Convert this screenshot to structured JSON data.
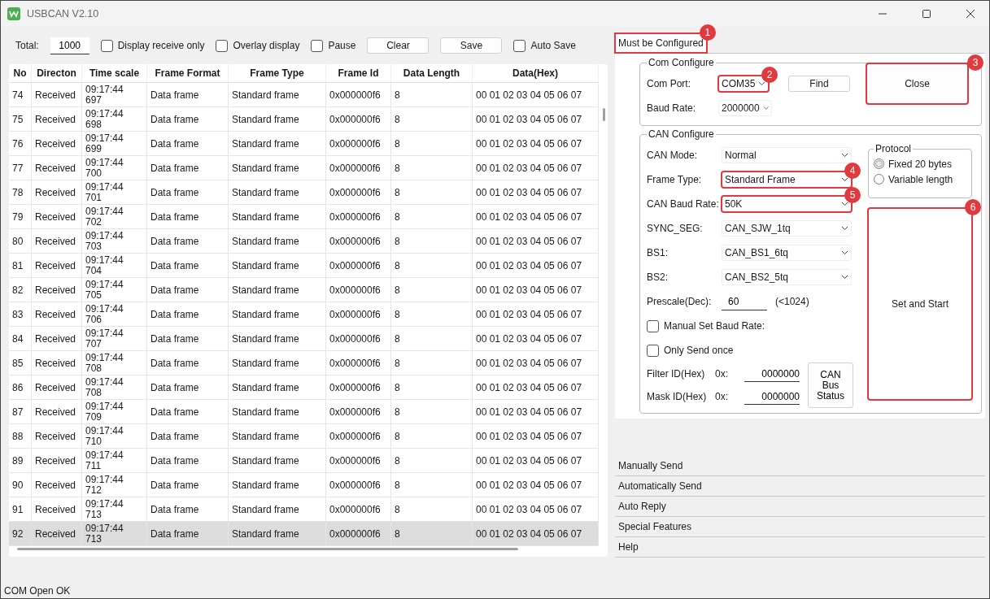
{
  "window": {
    "title": "USBCAN V2.10"
  },
  "toolbar": {
    "total_label": "Total:",
    "total_value": "1000",
    "items": [
      {
        "kind": "checkbox",
        "label": "Display receive only",
        "checked": false
      },
      {
        "kind": "checkbox",
        "label": "Overlay display",
        "checked": false
      },
      {
        "kind": "checkbox",
        "label": "Pause",
        "checked": false
      },
      {
        "kind": "button",
        "label": "Clear"
      },
      {
        "kind": "button",
        "label": "Save"
      },
      {
        "kind": "checkbox",
        "label": "Auto Save",
        "checked": false
      }
    ]
  },
  "table": {
    "columns": [
      "No",
      "Directon",
      "Time scale",
      "Frame Format",
      "Frame Type",
      "Frame Id",
      "Data Length",
      "Data(Hex)"
    ],
    "rows": [
      {
        "no": "74",
        "direction": "Received",
        "time": "09:17:44",
        "ms": "697",
        "format": "Data frame",
        "type": "Standard frame",
        "id": "0x000000f6",
        "length": "8",
        "data": "00 01 02 03 04 05 06 07",
        "selected": false
      },
      {
        "no": "75",
        "direction": "Received",
        "time": "09:17:44",
        "ms": "698",
        "format": "Data frame",
        "type": "Standard frame",
        "id": "0x000000f6",
        "length": "8",
        "data": "00 01 02 03 04 05 06 07",
        "selected": false
      },
      {
        "no": "76",
        "direction": "Received",
        "time": "09:17:44",
        "ms": "699",
        "format": "Data frame",
        "type": "Standard frame",
        "id": "0x000000f6",
        "length": "8",
        "data": "00 01 02 03 04 05 06 07",
        "selected": false
      },
      {
        "no": "77",
        "direction": "Received",
        "time": "09:17:44",
        "ms": "700",
        "format": "Data frame",
        "type": "Standard frame",
        "id": "0x000000f6",
        "length": "8",
        "data": "00 01 02 03 04 05 06 07",
        "selected": false
      },
      {
        "no": "78",
        "direction": "Received",
        "time": "09:17:44",
        "ms": "701",
        "format": "Data frame",
        "type": "Standard frame",
        "id": "0x000000f6",
        "length": "8",
        "data": "00 01 02 03 04 05 06 07",
        "selected": false
      },
      {
        "no": "79",
        "direction": "Received",
        "time": "09:17:44",
        "ms": "702",
        "format": "Data frame",
        "type": "Standard frame",
        "id": "0x000000f6",
        "length": "8",
        "data": "00 01 02 03 04 05 06 07",
        "selected": false
      },
      {
        "no": "80",
        "direction": "Received",
        "time": "09:17:44",
        "ms": "703",
        "format": "Data frame",
        "type": "Standard frame",
        "id": "0x000000f6",
        "length": "8",
        "data": "00 01 02 03 04 05 06 07",
        "selected": false
      },
      {
        "no": "81",
        "direction": "Received",
        "time": "09:17:44",
        "ms": "704",
        "format": "Data frame",
        "type": "Standard frame",
        "id": "0x000000f6",
        "length": "8",
        "data": "00 01 02 03 04 05 06 07",
        "selected": false
      },
      {
        "no": "82",
        "direction": "Received",
        "time": "09:17:44",
        "ms": "705",
        "format": "Data frame",
        "type": "Standard frame",
        "id": "0x000000f6",
        "length": "8",
        "data": "00 01 02 03 04 05 06 07",
        "selected": false
      },
      {
        "no": "83",
        "direction": "Received",
        "time": "09:17:44",
        "ms": "706",
        "format": "Data frame",
        "type": "Standard frame",
        "id": "0x000000f6",
        "length": "8",
        "data": "00 01 02 03 04 05 06 07",
        "selected": false
      },
      {
        "no": "84",
        "direction": "Received",
        "time": "09:17:44",
        "ms": "707",
        "format": "Data frame",
        "type": "Standard frame",
        "id": "0x000000f6",
        "length": "8",
        "data": "00 01 02 03 04 05 06 07",
        "selected": false
      },
      {
        "no": "85",
        "direction": "Received",
        "time": "09:17:44",
        "ms": "708",
        "format": "Data frame",
        "type": "Standard frame",
        "id": "0x000000f6",
        "length": "8",
        "data": "00 01 02 03 04 05 06 07",
        "selected": false
      },
      {
        "no": "86",
        "direction": "Received",
        "time": "09:17:44",
        "ms": "708",
        "format": "Data frame",
        "type": "Standard frame",
        "id": "0x000000f6",
        "length": "8",
        "data": "00 01 02 03 04 05 06 07",
        "selected": false
      },
      {
        "no": "87",
        "direction": "Received",
        "time": "09:17:44",
        "ms": "709",
        "format": "Data frame",
        "type": "Standard frame",
        "id": "0x000000f6",
        "length": "8",
        "data": "00 01 02 03 04 05 06 07",
        "selected": false
      },
      {
        "no": "88",
        "direction": "Received",
        "time": "09:17:44",
        "ms": "710",
        "format": "Data frame",
        "type": "Standard frame",
        "id": "0x000000f6",
        "length": "8",
        "data": "00 01 02 03 04 05 06 07",
        "selected": false
      },
      {
        "no": "89",
        "direction": "Received",
        "time": "09:17:44",
        "ms": "711",
        "format": "Data frame",
        "type": "Standard frame",
        "id": "0x000000f6",
        "length": "8",
        "data": "00 01 02 03 04 05 06 07",
        "selected": false
      },
      {
        "no": "90",
        "direction": "Received",
        "time": "09:17:44",
        "ms": "712",
        "format": "Data frame",
        "type": "Standard frame",
        "id": "0x000000f6",
        "length": "8",
        "data": "00 01 02 03 04 05 06 07",
        "selected": false
      },
      {
        "no": "91",
        "direction": "Received",
        "time": "09:17:44",
        "ms": "713",
        "format": "Data frame",
        "type": "Standard frame",
        "id": "0x000000f6",
        "length": "8",
        "data": "00 01 02 03 04 05 06 07",
        "selected": false
      },
      {
        "no": "92",
        "direction": "Received",
        "time": "09:17:44",
        "ms": "713",
        "format": "Data frame",
        "type": "Standard frame",
        "id": "0x000000f6",
        "length": "8",
        "data": "00 01 02 03 04 05 06 07",
        "selected": true
      }
    ]
  },
  "config_panel": {
    "main_section": {
      "title": "Must be Configured",
      "expanded": true,
      "callout": "1"
    },
    "com_configure": {
      "title": "Com Configure",
      "fields": [
        {
          "label": "Com Port:",
          "value": "COM35",
          "callout": "2"
        },
        {
          "label": "Baud Rate:",
          "value": "2000000"
        }
      ],
      "find_button": "Find",
      "close_button": {
        "label": "Close",
        "callout": "3"
      }
    },
    "can_configure": {
      "title": "CAN Configure",
      "fields": [
        {
          "label": "CAN Mode:",
          "value": "Normal"
        },
        {
          "label": "Frame Type:",
          "value": "Standard Frame",
          "callout": "4"
        },
        {
          "label": "CAN Baud Rate:",
          "value": "50K",
          "callout": "5"
        },
        {
          "label": "SYNC_SEG:",
          "value": "CAN_SJW_1tq"
        },
        {
          "label": "BS1:",
          "value": "CAN_BS1_6tq"
        },
        {
          "label": "BS2:",
          "value": "CAN_BS2_5tq"
        }
      ],
      "prescale": {
        "label": "Prescale(Dec):",
        "value": "60",
        "hint": "(<1024)"
      },
      "checkboxes": [
        {
          "label": "Manual Set Baud Rate:",
          "checked": false
        },
        {
          "label": "Only Send once",
          "checked": false
        }
      ],
      "id_fields": [
        {
          "label": "Filter ID(Hex)",
          "prefix": "0x:",
          "value": "0000000"
        },
        {
          "label": "Mask ID(Hex)",
          "prefix": "0x:",
          "value": "0000000"
        }
      ],
      "bus_status_button": "CAN Bus Status",
      "protocol": {
        "title": "Protocol",
        "options": [
          {
            "label": "Fixed 20 bytes",
            "selected": true
          },
          {
            "label": "Variable length",
            "selected": false
          }
        ]
      },
      "start_button": {
        "label": "Set and Start",
        "callout": "6"
      }
    },
    "sections": [
      {
        "title": "Manually Send",
        "expanded": false
      },
      {
        "title": "Automatically Send",
        "expanded": false
      },
      {
        "title": "Auto Reply",
        "expanded": false
      },
      {
        "title": "Special Features",
        "expanded": false
      },
      {
        "title": "Help",
        "expanded": false
      }
    ]
  },
  "status_bar": {
    "text": "COM Open OK"
  }
}
